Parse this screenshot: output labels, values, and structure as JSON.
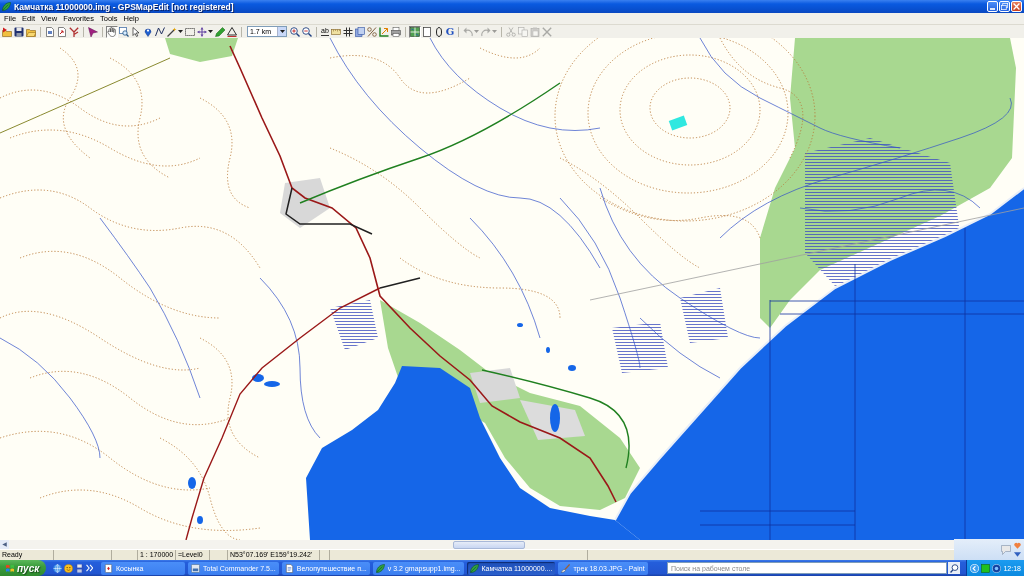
{
  "window": {
    "title": "Камчатка 11000000.img - GPSMapEdit [not registered]"
  },
  "menu": [
    "File",
    "Edit",
    "View",
    "Favorites",
    "Tools",
    "Help"
  ],
  "toolbar": {
    "items": [
      {
        "kind": "icon",
        "disabled": false,
        "pressed": false,
        "dropdown": false
      },
      {
        "kind": "icon",
        "disabled": false,
        "pressed": false,
        "dropdown": false
      },
      {
        "kind": "icon",
        "disabled": false,
        "pressed": false,
        "dropdown": false
      },
      {
        "kind": "separator"
      },
      {
        "kind": "icon",
        "disabled": false,
        "pressed": false,
        "dropdown": false
      },
      {
        "kind": "icon",
        "disabled": false,
        "pressed": false,
        "dropdown": false
      },
      {
        "kind": "icon",
        "disabled": false,
        "pressed": false,
        "dropdown": false
      },
      {
        "kind": "separator"
      },
      {
        "kind": "icon",
        "disabled": false,
        "pressed": false,
        "dropdown": false
      },
      {
        "kind": "separator"
      },
      {
        "kind": "icon",
        "disabled": false,
        "pressed": true,
        "dropdown": false
      },
      {
        "kind": "icon",
        "disabled": false,
        "pressed": false,
        "dropdown": false
      },
      {
        "kind": "icon",
        "disabled": false,
        "pressed": false,
        "dropdown": false
      },
      {
        "kind": "icon",
        "disabled": false,
        "pressed": false,
        "dropdown": false
      },
      {
        "kind": "icon",
        "disabled": false,
        "pressed": false,
        "dropdown": false
      },
      {
        "kind": "icon",
        "disabled": false,
        "pressed": false,
        "dropdown": true
      },
      {
        "kind": "icon",
        "disabled": false,
        "pressed": false,
        "dropdown": false
      },
      {
        "kind": "icon",
        "disabled": false,
        "pressed": false,
        "dropdown": true
      },
      {
        "kind": "icon",
        "disabled": false,
        "pressed": false,
        "dropdown": false
      },
      {
        "kind": "icon",
        "disabled": false,
        "pressed": false,
        "dropdown": false
      },
      {
        "kind": "separator"
      },
      {
        "kind": "combo",
        "value": "1.7 km"
      },
      {
        "kind": "icon",
        "disabled": false,
        "pressed": false,
        "dropdown": false
      },
      {
        "kind": "icon",
        "disabled": false,
        "pressed": false,
        "dropdown": false
      },
      {
        "kind": "separator"
      },
      {
        "kind": "caption",
        "label": "ab",
        "disabled": false,
        "pressed": false
      },
      {
        "kind": "icon",
        "disabled": false,
        "pressed": false,
        "dropdown": false
      },
      {
        "kind": "icon",
        "disabled": false,
        "pressed": false,
        "dropdown": false
      },
      {
        "kind": "icon",
        "disabled": false,
        "pressed": false,
        "dropdown": false
      },
      {
        "kind": "icon",
        "disabled": false,
        "pressed": false,
        "dropdown": false
      },
      {
        "kind": "icon",
        "disabled": false,
        "pressed": false,
        "dropdown": false
      },
      {
        "kind": "icon",
        "disabled": false,
        "pressed": false,
        "dropdown": false
      },
      {
        "kind": "separator"
      },
      {
        "kind": "icon",
        "disabled": false,
        "pressed": true,
        "dropdown": false
      },
      {
        "kind": "icon",
        "disabled": false,
        "pressed": false,
        "dropdown": false
      },
      {
        "kind": "icon",
        "disabled": false,
        "pressed": false,
        "dropdown": false
      },
      {
        "kind": "letter",
        "label": "G",
        "disabled": false,
        "pressed": false
      },
      {
        "kind": "separator"
      },
      {
        "kind": "icon",
        "disabled": true,
        "pressed": false,
        "dropdown": true
      },
      {
        "kind": "icon",
        "disabled": true,
        "pressed": false,
        "dropdown": true
      },
      {
        "kind": "separator"
      },
      {
        "kind": "icon",
        "disabled": true,
        "pressed": false,
        "dropdown": false
      },
      {
        "kind": "icon",
        "disabled": true,
        "pressed": false,
        "dropdown": false
      },
      {
        "kind": "icon",
        "disabled": true,
        "pressed": false,
        "dropdown": false
      },
      {
        "kind": "icon",
        "disabled": true,
        "pressed": false,
        "dropdown": false
      }
    ]
  },
  "status_bar": {
    "panels": [
      {
        "kind": "text",
        "text": "Ready"
      },
      {
        "kind": "empty"
      },
      {
        "kind": "empty"
      },
      {
        "kind": "text",
        "text": "1 : 170000"
      },
      {
        "kind": "text",
        "text": "=Level0"
      },
      {
        "kind": "empty"
      },
      {
        "kind": "text",
        "text": "N53°07.169' E159°19.242'"
      },
      {
        "kind": "empty"
      },
      {
        "kind": "empty"
      },
      {
        "kind": "empty"
      }
    ]
  },
  "taskbar": {
    "start": "пуск",
    "tasks": [
      {
        "label": "Косынка",
        "selected": false
      },
      {
        "label": "Total Commander 7.5...",
        "selected": false
      },
      {
        "label": "Велопутешествие п...",
        "selected": false
      },
      {
        "label": "v 3.2 gmapsupp1.img...",
        "selected": false
      },
      {
        "label": "Камчатка 11000000....",
        "selected": true
      },
      {
        "label": "трек 18.03.JPG - Paint",
        "selected": false
      }
    ],
    "search": {
      "placeholder": "Поиск на рабочем столе"
    },
    "clock": "12:18"
  }
}
